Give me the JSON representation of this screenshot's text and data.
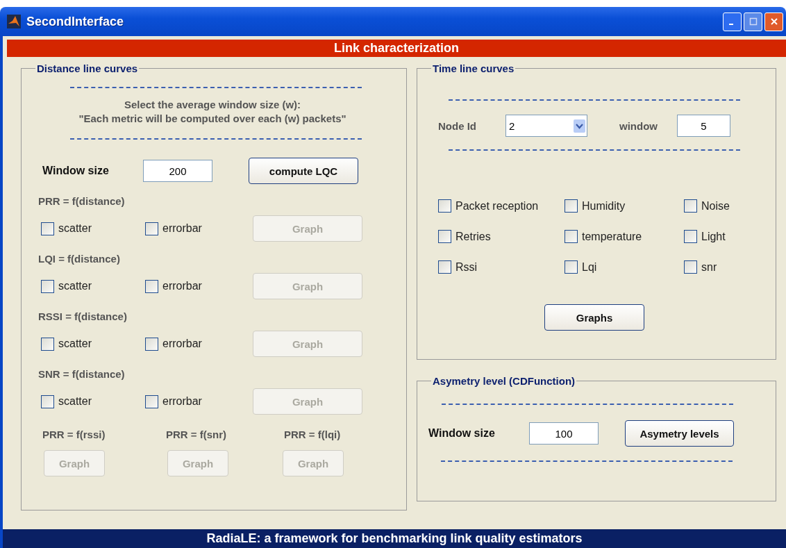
{
  "window": {
    "title": "SecondInterface"
  },
  "header": "Link characterization",
  "distance_panel": {
    "title": "Distance line curves",
    "instructions": [
      "Select the average window size (w):",
      "\"Each metric will be computed over each (w) packets\""
    ],
    "window_size_label": "Window size",
    "window_size_value": "200",
    "compute_button": {
      "label": "compute LQC",
      "disabled": false
    },
    "metrics": [
      {
        "label": "PRR = f(distance)",
        "options": [
          {
            "label": "scatter",
            "checked": false
          },
          {
            "label": "errorbar",
            "checked": false
          }
        ],
        "button": {
          "label": "Graph",
          "disabled": true
        }
      },
      {
        "label": "LQI = f(distance)",
        "options": [
          {
            "label": "scatter",
            "checked": false
          },
          {
            "label": "errorbar",
            "checked": false
          }
        ],
        "button": {
          "label": "Graph",
          "disabled": true
        }
      },
      {
        "label": "RSSI = f(distance)",
        "options": [
          {
            "label": "scatter",
            "checked": false
          },
          {
            "label": "errorbar",
            "checked": false
          }
        ],
        "button": {
          "label": "Graph",
          "disabled": true
        }
      },
      {
        "label": "SNR = f(distance)",
        "options": [
          {
            "label": "scatter",
            "checked": false
          },
          {
            "label": "errorbar",
            "checked": false
          }
        ],
        "button": {
          "label": "Graph",
          "disabled": true
        }
      }
    ],
    "prr_plots": [
      {
        "label": "PRR = f(rssi)",
        "button": {
          "label": "Graph",
          "disabled": true
        }
      },
      {
        "label": "PRR = f(snr)",
        "button": {
          "label": "Graph",
          "disabled": true
        }
      },
      {
        "label": "PRR = f(lqi)",
        "button": {
          "label": "Graph",
          "disabled": true
        }
      }
    ]
  },
  "time_panel": {
    "title": "Time line curves",
    "node_label": "Node Id",
    "node_value": "2",
    "window_label": "window",
    "window_value": "5",
    "checkboxes": [
      {
        "label": "Packet reception",
        "checked": false
      },
      {
        "label": "Humidity",
        "checked": false
      },
      {
        "label": "Noise",
        "checked": false
      },
      {
        "label": "Retries",
        "checked": false
      },
      {
        "label": "temperature",
        "checked": false
      },
      {
        "label": "Light",
        "checked": false
      },
      {
        "label": "Rssi",
        "checked": false
      },
      {
        "label": "Lqi",
        "checked": false
      },
      {
        "label": "snr",
        "checked": false
      }
    ],
    "graphs_button": {
      "label": "Graphs",
      "disabled": false
    }
  },
  "asymmetry_panel": {
    "title": "Asymetry level (CDFunction)",
    "window_size_label": "Window size",
    "window_size_value": "100",
    "button": {
      "label": "Asymetry levels",
      "disabled": false
    }
  },
  "footer": "RadiaLE: a framework for benchmarking link quality estimators"
}
